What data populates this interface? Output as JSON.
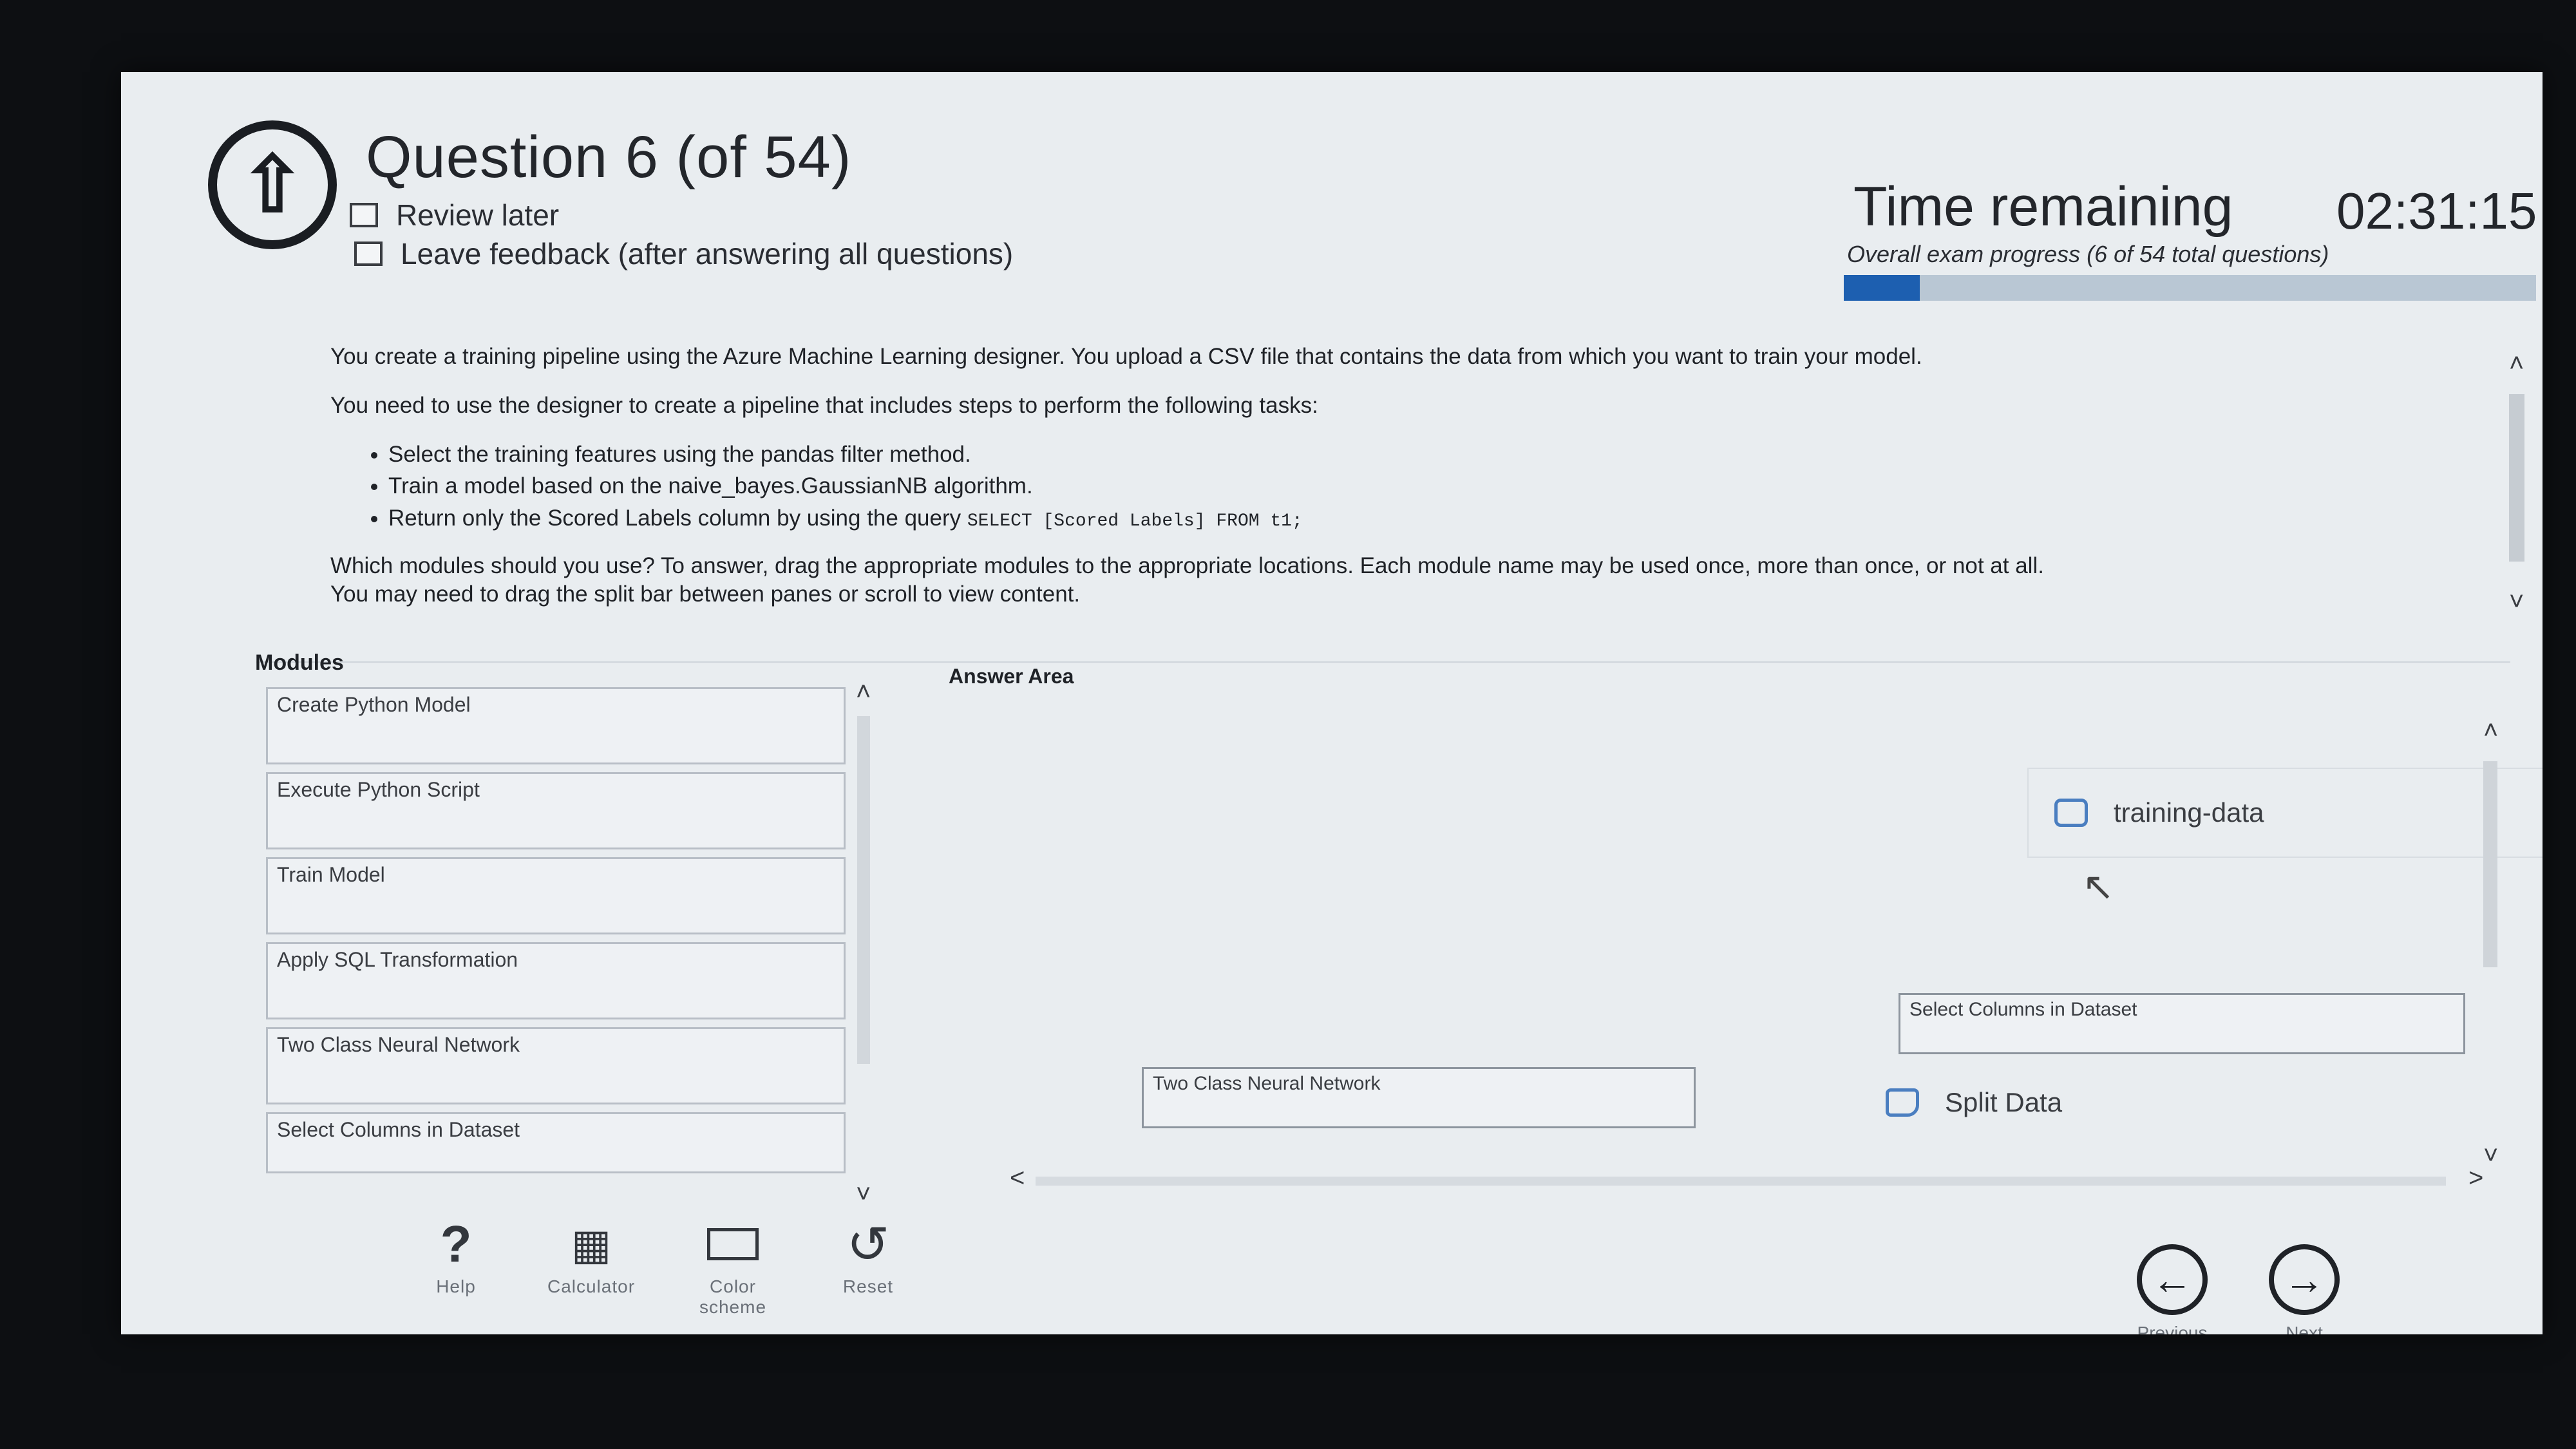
{
  "header": {
    "question_title": "Question 6 (of 54)",
    "review_later": "Review later",
    "leave_feedback": "Leave feedback (after answering all questions)",
    "time_label": "Time remaining",
    "time_value": "02:31:15",
    "progress_label": "Overall exam progress (6 of 54 total questions)",
    "progress_fraction": 0.11,
    "progress_color": "#1d5fb0"
  },
  "question": {
    "para1": "You create a training pipeline using the Azure Machine Learning designer. You upload a CSV file that contains the data from which you want to train your model.",
    "para2": "You need to use the designer to create a pipeline that includes steps to perform the following tasks:",
    "task1": "Select the training features using the pandas filter method.",
    "task2": "Train a model based on the naive_bayes.GaussianNB algorithm.",
    "task3_prefix": "Return only the Scored Labels column by using the query",
    "task3_code": "SELECT [Scored Labels] FROM t1;",
    "instructions1": "Which modules should you use? To answer, drag the appropriate modules to the appropriate locations. Each module name may be used once, more than once, or not at all.",
    "instructions2": "You may need to drag the split bar between panes or scroll to view content."
  },
  "modules": {
    "heading": "Modules",
    "items": [
      "Create Python Model",
      "Execute Python Script",
      "Train Model",
      "Apply SQL Transformation",
      "Two Class Neural Network",
      "Select Columns in Dataset"
    ]
  },
  "answer_area": {
    "heading": "Answer Area",
    "training_data": "training-data",
    "select_columns": "Select Columns in Dataset",
    "two_class": "Two Class Neural Network",
    "split_data": "Split Data"
  },
  "toolbar": {
    "help": "Help",
    "calculator": "Calculator",
    "color_scheme": "Color scheme",
    "reset": "Reset",
    "previous": "Previous",
    "next": "Next"
  },
  "icons": {
    "back": "back-arrow-icon",
    "help": "question-mark-icon",
    "calculator": "calculator-icon",
    "color_scheme": "monitor-icon",
    "reset": "reset-icon",
    "previous": "arrow-left-icon",
    "next": "arrow-right-icon",
    "dataset": "database-icon"
  }
}
